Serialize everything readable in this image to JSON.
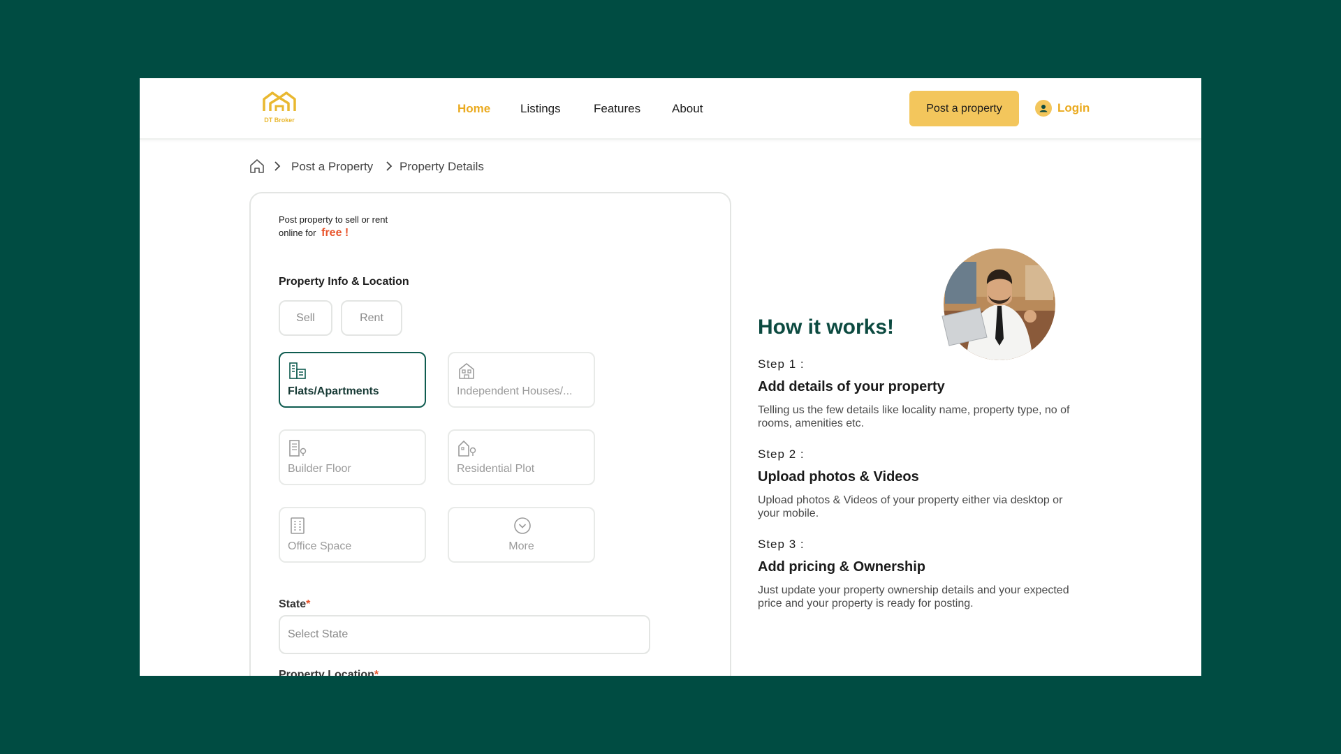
{
  "brand": {
    "name": "DT Broker",
    "accent_color": "#eaaa1f",
    "primary_color": "#0c4a40"
  },
  "nav": {
    "items": [
      {
        "label": "Home",
        "active": true
      },
      {
        "label": "Listings",
        "active": false
      },
      {
        "label": "Features",
        "active": false
      },
      {
        "label": "About",
        "active": false
      }
    ],
    "post_button": "Post a property",
    "login": "Login"
  },
  "breadcrumb": {
    "home_icon": "home-icon",
    "items": [
      "Post a Property",
      "Property Details"
    ]
  },
  "form": {
    "promo_line1": "Post property to sell or rent",
    "promo_line2": "online for",
    "promo_free": "free !",
    "section_title": "Property Info & Location",
    "listing_types": [
      "Sell",
      "Rent"
    ],
    "property_types": [
      {
        "label": "Flats/Apartments",
        "icon": "apartment-building-icon",
        "selected": true
      },
      {
        "label": "Independent Houses/...",
        "icon": "house-icon",
        "selected": false
      },
      {
        "label": "Builder Floor",
        "icon": "builder-floor-icon",
        "selected": false
      },
      {
        "label": "Residential Plot",
        "icon": "residential-plot-icon",
        "selected": false
      },
      {
        "label": "Office Space",
        "icon": "office-building-icon",
        "selected": false
      },
      {
        "label": "More",
        "icon": "chevron-down-circle-icon",
        "selected": false
      }
    ],
    "state_label": "State",
    "state_placeholder": "Select State",
    "location_label": "Property Location",
    "required_mark": "*"
  },
  "how_it_works": {
    "title": "How it works!",
    "steps": [
      {
        "number": "Step 1 :",
        "title": "Add details of your property",
        "desc": "Telling us the few details like locality name, property type, no of rooms, amenities etc."
      },
      {
        "number": "Step 2 :",
        "title": "Upload photos & Videos",
        "desc": "Upload photos & Videos of your property either via desktop or your mobile."
      },
      {
        "number": "Step 3 :",
        "title": "Add pricing & Ownership",
        "desc": "Just update your property ownership details and your expected price and your property is ready for posting."
      }
    ]
  }
}
